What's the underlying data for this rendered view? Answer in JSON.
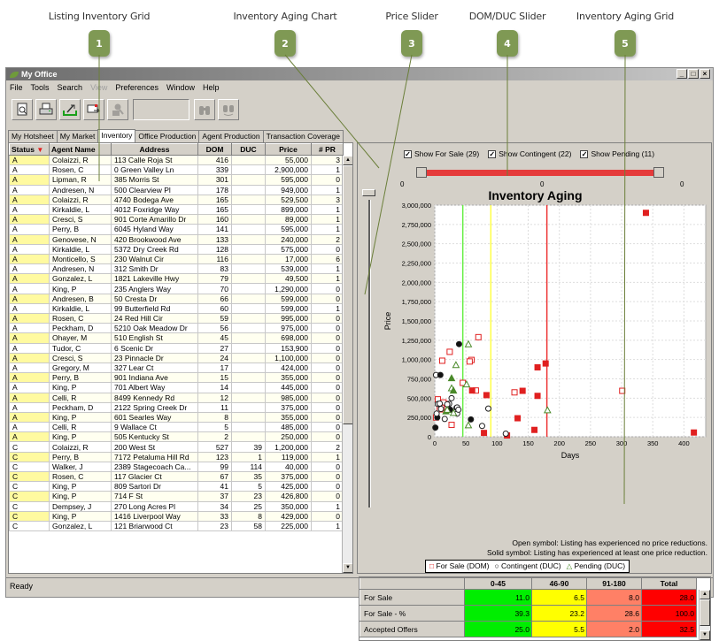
{
  "callouts": [
    {
      "n": "1",
      "label": "Listing Inventory Grid"
    },
    {
      "n": "2",
      "label": "Inventory Aging Chart"
    },
    {
      "n": "3",
      "label": "Price Slider"
    },
    {
      "n": "4",
      "label": "DOM/DUC Slider"
    },
    {
      "n": "5",
      "label": "Inventory Aging Grid"
    }
  ],
  "window": {
    "title": "My Office",
    "minimize": "_",
    "maximize": "□",
    "close": "×"
  },
  "menu": [
    {
      "label": "File",
      "enabled": true
    },
    {
      "label": "Tools",
      "enabled": true
    },
    {
      "label": "Search",
      "enabled": true
    },
    {
      "label": "View",
      "enabled": false
    },
    {
      "label": "Preferences",
      "enabled": true
    },
    {
      "label": "Window",
      "enabled": true
    },
    {
      "label": "Help",
      "enabled": true
    }
  ],
  "toolbar": {
    "buttons": [
      "print-preview-icon",
      "print-icon",
      "export-icon",
      "send-icon",
      "search-user-icon"
    ],
    "search_value": "",
    "find_buttons": [
      "binoculars-icon",
      "find-next-icon"
    ]
  },
  "tabs": [
    {
      "label": "My Hotsheet",
      "active": false
    },
    {
      "label": "My Market",
      "active": false
    },
    {
      "label": "Inventory",
      "active": true
    },
    {
      "label": "Office Production",
      "active": false
    },
    {
      "label": "Agent Production",
      "active": false
    },
    {
      "label": "Transaction Coverage",
      "active": false
    }
  ],
  "inventory": {
    "columns": [
      "Status",
      "Agent Name",
      "Address",
      "DOM",
      "DUC",
      "Price",
      "# PR"
    ],
    "sort_indicator": "▼",
    "rows": [
      [
        "A",
        "Colaizzi, R",
        "113 Calle Roja St",
        "416",
        "",
        "55,000",
        "3"
      ],
      [
        "A",
        "Rosen, C",
        "0 Green Valley Ln",
        "339",
        "",
        "2,900,000",
        "1"
      ],
      [
        "A",
        "Lipman, R",
        "385 Morris St",
        "301",
        "",
        "595,000",
        "0"
      ],
      [
        "A",
        "Andresen, N",
        "500 Clearview Pl",
        "178",
        "",
        "949,000",
        "1"
      ],
      [
        "A",
        "Colaizzi, R",
        "4740 Bodega Ave",
        "165",
        "",
        "529,500",
        "3"
      ],
      [
        "A",
        "Kirkaldie, L",
        "4012 Foxridge Way",
        "165",
        "",
        "899,000",
        "1"
      ],
      [
        "A",
        "Cresci, S",
        "901 Corte Amarillo Dr",
        "160",
        "",
        "89,000",
        "1"
      ],
      [
        "A",
        "Perry, B",
        "6045 Hyland Way",
        "141",
        "",
        "595,000",
        "1"
      ],
      [
        "A",
        "Genovese, N",
        "420 Brookwood Ave",
        "133",
        "",
        "240,000",
        "2"
      ],
      [
        "A",
        "Kirkaldie, L",
        "5372 Dry Creek Rd",
        "128",
        "",
        "575,000",
        "0"
      ],
      [
        "A",
        "Monticello, S",
        "230 Walnut Cir",
        "116",
        "",
        "17,000",
        "6"
      ],
      [
        "A",
        "Andresen, N",
        "312 Smith Dr",
        "83",
        "",
        "539,000",
        "1"
      ],
      [
        "A",
        "Gonzalez, L",
        "1821 Lakeville Hwy",
        "79",
        "",
        "49,500",
        "1"
      ],
      [
        "A",
        "King, P",
        "235 Anglers Way",
        "70",
        "",
        "1,290,000",
        "0"
      ],
      [
        "A",
        "Andresen, B",
        "50 Cresta Dr",
        "66",
        "",
        "599,000",
        "0"
      ],
      [
        "A",
        "Kirkaldie, L",
        "99 Butterfield Rd",
        "60",
        "",
        "599,000",
        "1"
      ],
      [
        "A",
        "Rosen, C",
        "24 Red Hill Cir",
        "59",
        "",
        "995,000",
        "0"
      ],
      [
        "A",
        "Peckham, D",
        "5210 Oak Meadow Dr",
        "56",
        "",
        "975,000",
        "0"
      ],
      [
        "A",
        "Ohayer, M",
        "510 English St",
        "45",
        "",
        "698,000",
        "0"
      ],
      [
        "A",
        "Tudor, C",
        "6 Scenic Dr",
        "27",
        "",
        "153,900",
        "0"
      ],
      [
        "A",
        "Cresci, S",
        "23 Pinnacle Dr",
        "24",
        "",
        "1,100,000",
        "0"
      ],
      [
        "A",
        "Gregory, M",
        "327 Lear Ct",
        "17",
        "",
        "424,000",
        "0"
      ],
      [
        "A",
        "Perry, B",
        "901 Indiana Ave",
        "15",
        "",
        "355,000",
        "0"
      ],
      [
        "A",
        "King, P",
        "701 Albert Way",
        "14",
        "",
        "445,000",
        "0"
      ],
      [
        "A",
        "Celli, R",
        "8499 Kennedy Rd",
        "12",
        "",
        "985,000",
        "0"
      ],
      [
        "A",
        "Peckham, D",
        "2122 Spring Creek Dr",
        "11",
        "",
        "375,000",
        "0"
      ],
      [
        "A",
        "King, P",
        "601 Searles Way",
        "8",
        "",
        "355,000",
        "0"
      ],
      [
        "A",
        "Celli, R",
        "9 Wallace Ct",
        "5",
        "",
        "485,000",
        "0"
      ],
      [
        "A",
        "King, P",
        "505 Kentucky St",
        "2",
        "",
        "250,000",
        "0"
      ],
      [
        "C",
        "Colaizzi, R",
        "200 West St",
        "527",
        "39",
        "1,200,000",
        "2"
      ],
      [
        "C",
        "Perry, B",
        "7172 Petaluma Hill Rd",
        "123",
        "1",
        "119,000",
        "1"
      ],
      [
        "C",
        "Walker, J",
        "2389 Stagecoach Ca...",
        "99",
        "114",
        "40,000",
        "0"
      ],
      [
        "C",
        "Rosen, C",
        "117 Glacier Ct",
        "67",
        "35",
        "375,000",
        "0"
      ],
      [
        "C",
        "King, P",
        "809 Sartori Dr",
        "41",
        "5",
        "425,000",
        "0"
      ],
      [
        "C",
        "King, P",
        "714 F St",
        "37",
        "23",
        "426,800",
        "0"
      ],
      [
        "C",
        "Dempsey, J",
        "270 Long Acres Pl",
        "34",
        "25",
        "350,000",
        "1"
      ],
      [
        "C",
        "King, P",
        "1416 Liverpool Way",
        "33",
        "8",
        "429,000",
        "0"
      ],
      [
        "C",
        "Gonzalez, L",
        "121 Briarwood Ct",
        "23",
        "58",
        "225,000",
        "1"
      ]
    ]
  },
  "filters": [
    {
      "label": "Show For Sale (29)",
      "checked": true
    },
    {
      "label": "Show Contingent (22)",
      "checked": true
    },
    {
      "label": "Show Pending (11)",
      "checked": true
    }
  ],
  "dom_slider": {
    "min_label": "0",
    "mid_label": "0",
    "max_label": "0",
    "low_fraction": 0,
    "high_fraction": 1
  },
  "price_slider": {
    "value_fraction": 1
  },
  "chart_data": {
    "type": "scatter",
    "title": "Inventory Aging",
    "xlabel": "Days",
    "ylabel": "Price",
    "xlim": [
      0,
      435
    ],
    "ylim": [
      0,
      3000000
    ],
    "xticks": [
      0,
      50,
      100,
      150,
      200,
      250,
      300,
      350,
      400
    ],
    "yticks": [
      0,
      250000,
      500000,
      750000,
      1000000,
      1250000,
      1500000,
      1750000,
      2000000,
      2250000,
      2500000,
      2750000,
      3000000
    ],
    "ytick_labels": [
      "0",
      "250,000",
      "500,000",
      "750,000",
      "1,000,000",
      "1,250,000",
      "1,500,000",
      "1,750,000",
      "2,000,000",
      "2,250,000",
      "2,500,000",
      "2,750,000",
      "3,000,000"
    ],
    "grid": true,
    "thresholds": [
      {
        "x": 45,
        "color": "#66ee44"
      },
      {
        "x": 90,
        "color": "#ffff44"
      },
      {
        "x": 180,
        "color": "#ee3333"
      }
    ],
    "series": [
      {
        "name": "For Sale (DOM)",
        "marker": "square",
        "color": "#e02020",
        "points": [
          [
            416,
            55000,
            1
          ],
          [
            339,
            2900000,
            1
          ],
          [
            301,
            595000,
            0
          ],
          [
            178,
            949000,
            1
          ],
          [
            165,
            529500,
            1
          ],
          [
            165,
            899000,
            1
          ],
          [
            160,
            89000,
            1
          ],
          [
            141,
            595000,
            1
          ],
          [
            133,
            240000,
            1
          ],
          [
            128,
            575000,
            0
          ],
          [
            116,
            17000,
            1
          ],
          [
            83,
            539000,
            1
          ],
          [
            79,
            49500,
            1
          ],
          [
            70,
            1290000,
            0
          ],
          [
            66,
            599000,
            0
          ],
          [
            60,
            599000,
            1
          ],
          [
            59,
            995000,
            0
          ],
          [
            56,
            975000,
            0
          ],
          [
            45,
            698000,
            0
          ],
          [
            27,
            153900,
            0
          ],
          [
            24,
            1100000,
            0
          ],
          [
            17,
            424000,
            0
          ],
          [
            15,
            355000,
            0
          ],
          [
            14,
            445000,
            0
          ],
          [
            12,
            985000,
            0
          ],
          [
            11,
            375000,
            0
          ],
          [
            8,
            355000,
            0
          ],
          [
            5,
            485000,
            0
          ],
          [
            2,
            250000,
            0
          ]
        ]
      },
      {
        "name": "Contingent (DUC)",
        "marker": "circle",
        "color": "#202020",
        "points": [
          [
            39,
            1200000,
            1
          ],
          [
            1,
            119000,
            1
          ],
          [
            114,
            40000,
            0
          ],
          [
            35,
            375000,
            0
          ],
          [
            5,
            425000,
            0
          ],
          [
            23,
            426800,
            0
          ],
          [
            25,
            350000,
            1
          ],
          [
            8,
            429000,
            0
          ],
          [
            58,
            225000,
            1
          ],
          [
            86,
            365000,
            0
          ],
          [
            27,
            500000,
            0
          ],
          [
            76,
            140000,
            0
          ],
          [
            36,
            300000,
            0
          ],
          [
            16,
            230000,
            0
          ],
          [
            2,
            800000,
            0
          ],
          [
            9,
            800000,
            1
          ],
          [
            4,
            250000,
            1
          ],
          [
            36,
            380000,
            0
          ],
          [
            3,
            300000,
            0
          ],
          [
            20,
            420000,
            0
          ],
          [
            10,
            360000,
            0
          ],
          [
            38,
            350000,
            0
          ]
        ]
      },
      {
        "name": "Pending (DUC)",
        "marker": "triangle",
        "color": "#4a8a2a",
        "points": [
          [
            54,
            1200000,
            0
          ],
          [
            34,
            930000,
            0
          ],
          [
            27,
            760000,
            1
          ],
          [
            27,
            630000,
            0
          ],
          [
            30,
            600000,
            1
          ],
          [
            51,
            680000,
            0
          ],
          [
            18,
            330000,
            1
          ],
          [
            30,
            310000,
            0
          ],
          [
            54,
            150000,
            0
          ],
          [
            181,
            345000,
            0
          ],
          [
            20,
            350000,
            0
          ]
        ]
      }
    ],
    "notes": [
      "Open symbol:  Listing has experienced no price reductions.",
      "Solid symbol:  Listing has experienced at least one price reduction."
    ],
    "legend": [
      "For Sale (DOM)",
      "Contingent (DUC)",
      "Pending (DUC)"
    ],
    "legend_position": "bottom"
  },
  "aging_grid": {
    "columns": [
      "",
      "0-45",
      "46-90",
      "91-180",
      "Total"
    ],
    "colors": [
      "#00ee00",
      "#ffff00",
      "#ff8066",
      "#ff0000"
    ],
    "rows": [
      {
        "label": "For Sale",
        "values": [
          "11.0",
          "6.5",
          "8.0",
          "28.0"
        ]
      },
      {
        "label": "For Sale - %",
        "values": [
          "39.3",
          "23.2",
          "28.6",
          "100.0"
        ]
      },
      {
        "label": "Accepted Offers",
        "values": [
          "25.0",
          "5.5",
          "2.0",
          "32.5"
        ]
      }
    ]
  },
  "status": "Ready"
}
